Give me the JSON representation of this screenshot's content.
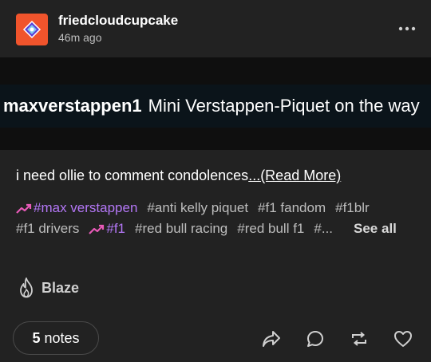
{
  "header": {
    "username": "friedcloudcupcake",
    "timestamp": "46m ago"
  },
  "image": {
    "banner_user": "maxverstappen1",
    "banner_text": "Mini Verstappen-Piquet on the way"
  },
  "body": {
    "text": "i need ollie to comment condolences",
    "read_more": "...(Read More)"
  },
  "tags": [
    {
      "label": "#max verstappen",
      "trending": true
    },
    {
      "label": "#anti kelly piquet",
      "trending": false
    },
    {
      "label": "#f1 fandom",
      "trending": false
    },
    {
      "label": "#f1blr",
      "trending": false
    },
    {
      "label": "#f1 drivers",
      "trending": false
    },
    {
      "label": "#f1",
      "trending": true
    },
    {
      "label": "#red bull racing",
      "trending": false
    },
    {
      "label": "#red bull f1",
      "trending": false
    },
    {
      "label": "#...",
      "trending": false
    }
  ],
  "see_all": "See all",
  "blaze": "Blaze",
  "footer": {
    "notes_count": "5",
    "notes_label": "notes"
  },
  "colors": {
    "background": "#222222",
    "avatar": "#f0542c",
    "trending_tag": "#b377f5",
    "secondary_text": "#bdbdbd"
  },
  "icons": [
    "avatar-logo-icon",
    "more-dots-icon",
    "trending-arrow-icon",
    "flame-icon",
    "share-icon",
    "reply-icon",
    "reblog-icon",
    "heart-icon"
  ]
}
